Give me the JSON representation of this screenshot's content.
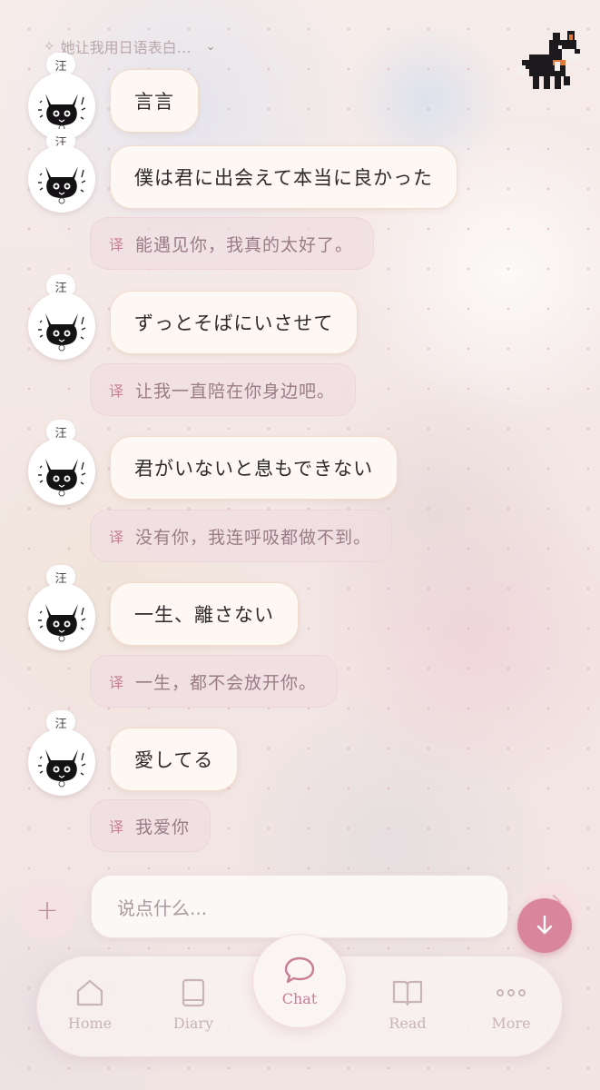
{
  "header": {
    "sparkle_icon": "sparkle-icon",
    "title": "她让我用日语表白…",
    "chevron_icon": "chevron-down-icon"
  },
  "avatar_tag": "汪",
  "messages": [
    {
      "text": "言言",
      "translation": null
    },
    {
      "text": "僕は君に出会えて本当に良かった",
      "translation": "能遇见你，我真的太好了。"
    },
    {
      "text": "ずっとそばにいさせて",
      "translation": "让我一直陪在你身边吧。"
    },
    {
      "text": "君がいないと息もできない",
      "translation": "没有你，我连呼吸都做不到。"
    },
    {
      "text": "一生、離さない",
      "translation": "一生，都不会放开你。"
    },
    {
      "text": "愛してる",
      "translation": "我爱你"
    }
  ],
  "translation_marker": "译",
  "composer": {
    "placeholder": "说点什么...",
    "plus_icon": "plus-icon",
    "send_icon": "send-arrow-icon",
    "scroll_icon": "arrow-down-icon"
  },
  "nav": {
    "items": [
      {
        "label": "Home",
        "icon": "home-icon"
      },
      {
        "label": "Diary",
        "icon": "book-icon"
      },
      {
        "label": "Chat",
        "icon": "chat-bubble-icon",
        "active": true
      },
      {
        "label": "Read",
        "icon": "open-book-icon"
      },
      {
        "label": "More",
        "icon": "ellipsis-icon"
      }
    ]
  },
  "colors": {
    "accent": "#d9869c",
    "bubble": "#fdf8f3",
    "translation_bg": "#f0dee2"
  }
}
